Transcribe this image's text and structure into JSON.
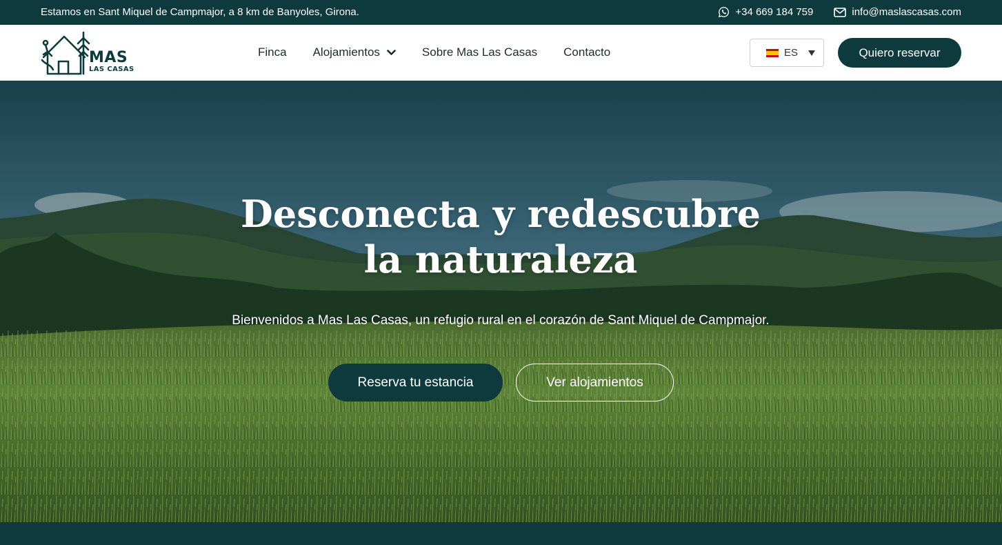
{
  "topbar": {
    "address": "Estamos en Sant Miquel de Campmajor, a 8 km de Banyoles, Girona.",
    "phone": "+34 669 184 759",
    "email": "info@maslascasas.com"
  },
  "logo": {
    "line1": "MAS",
    "line2": "LAS CASAS"
  },
  "nav": {
    "items": [
      {
        "label": "Finca"
      },
      {
        "label": "Alojamientos"
      },
      {
        "label": "Sobre Mas Las Casas"
      },
      {
        "label": "Contacto"
      }
    ]
  },
  "language": {
    "selected": "ES"
  },
  "cta": {
    "book_label": "Quiero reservar"
  },
  "hero": {
    "title": "Desconecta y redescubre la naturaleza",
    "subtitle": "Bienvenidos a Mas Las Casas, un refugio rural en el corazón de Sant Miquel de Campmajor.",
    "primary_button": "Reserva tu estancia",
    "secondary_button": "Ver alojamientos"
  },
  "colors": {
    "brand": "#0f3a3d",
    "white": "#ffffff"
  }
}
